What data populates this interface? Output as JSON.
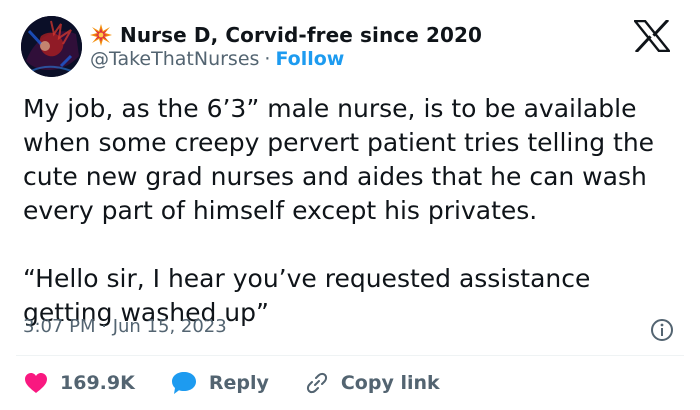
{
  "author": {
    "display_name": "Nurse D, Corvid-free since 2020",
    "handle": "@TakeThatNurses",
    "separator": "·",
    "follow_label": "Follow"
  },
  "tweet": {
    "paragraphs": [
      "My job, as the 6’3” male nurse, is to be available when some creepy pervert patient tries telling the cute new grad nurses and aides that he can wash every part of himself except his privates.",
      "“Hello sir, I hear you’ve requested assistance getting washed up”"
    ],
    "timestamp": "3:07 PM · Jun 15, 2023"
  },
  "actions": {
    "like_count": "169.9K",
    "reply_label": "Reply",
    "copy_link_label": "Copy link"
  },
  "icons": {
    "burst": "collision-burst-icon",
    "platform": "x-logo-icon",
    "info": "info-icon",
    "like": "heart-icon",
    "reply": "speech-bubble-icon",
    "copy": "link-icon"
  },
  "colors": {
    "text": "#0f1419",
    "secondary": "#536471",
    "accent": "#1d9bf0",
    "like": "#f91880",
    "divider": "#eff3f4"
  }
}
